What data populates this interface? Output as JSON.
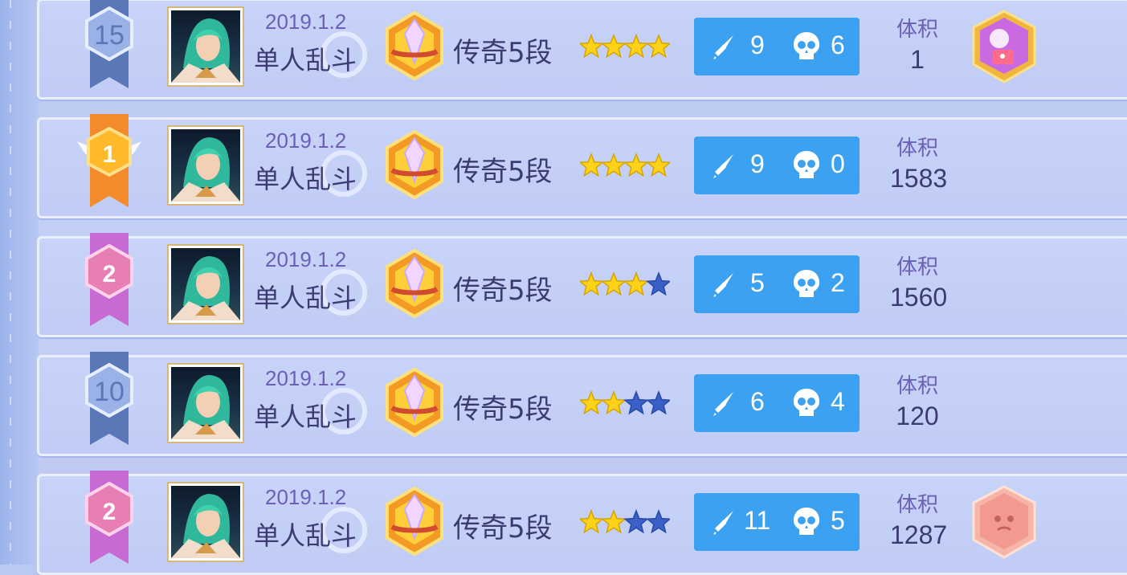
{
  "rows": [
    {
      "rank": "15",
      "rank_style": "plain",
      "date": "2019.1.2",
      "mode": "单人乱斗",
      "tier": "传奇5段",
      "stars_filled": 4,
      "stars_total": 4,
      "kills": "9",
      "deaths": "6",
      "volume_label": "体积",
      "volume": "1",
      "achievement": "purple-badge-icon"
    },
    {
      "rank": "1",
      "rank_style": "gold",
      "date": "2019.1.2",
      "mode": "单人乱斗",
      "tier": "传奇5段",
      "stars_filled": 4,
      "stars_total": 4,
      "kills": "9",
      "deaths": "0",
      "volume_label": "体积",
      "volume": "1583",
      "achievement": null
    },
    {
      "rank": "2",
      "rank_style": "pink",
      "date": "2019.1.2",
      "mode": "单人乱斗",
      "tier": "传奇5段",
      "stars_filled": 3,
      "stars_total": 4,
      "kills": "5",
      "deaths": "2",
      "volume_label": "体积",
      "volume": "1560",
      "achievement": null
    },
    {
      "rank": "10",
      "rank_style": "plain",
      "date": "2019.1.2",
      "mode": "单人乱斗",
      "tier": "传奇5段",
      "stars_filled": 2,
      "stars_total": 4,
      "kills": "6",
      "deaths": "4",
      "volume_label": "体积",
      "volume": "120",
      "achievement": null
    },
    {
      "rank": "2",
      "rank_style": "pink",
      "date": "2019.1.2",
      "mode": "单人乱斗",
      "tier": "传奇5段",
      "stars_filled": 2,
      "stars_total": 4,
      "kills": "11",
      "deaths": "5",
      "volume_label": "体积",
      "volume": "1287",
      "achievement": "pink-badge-icon"
    }
  ],
  "colors": {
    "kd_panel": "#3ba1f0",
    "star_filled": "#ffd21a",
    "star_empty": "#3a5fc6",
    "date_text": "#6b5fb6",
    "main_text": "#3b3b72"
  }
}
